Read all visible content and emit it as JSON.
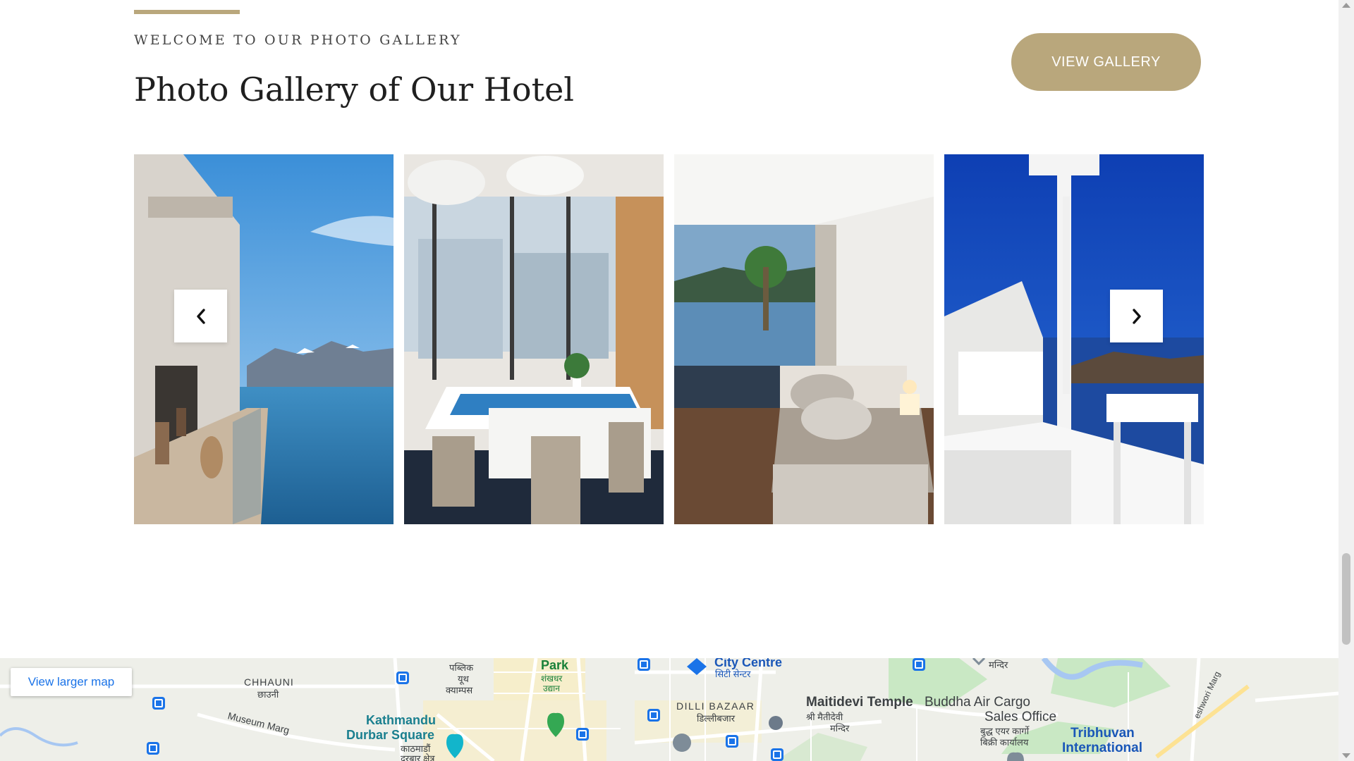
{
  "section": {
    "eyebrow": "WELCOME TO OUR PHOTO GALLERY",
    "title": "Photo Gallery of Our Hotel",
    "view_gallery_label": "VIEW GALLERY"
  },
  "gallery": {
    "photos": [
      {
        "subject": "lakeside balcony with mountains"
      },
      {
        "subject": "restaurant dining room with city view"
      },
      {
        "subject": "bedroom with lake view window"
      },
      {
        "subject": "white terrace with sea view"
      }
    ],
    "prev_icon": "chevron-left-icon",
    "next_icon": "chevron-right-icon"
  },
  "map": {
    "larger_map_label": "View larger map",
    "labels": {
      "chhauni": "CHHAUNI",
      "chhauni_np": "छाउनी",
      "museum_marg": "Museum Marg",
      "durbar_1": "Kathmandu",
      "durbar_2": "Durbar Square",
      "durbar_np": "काठमाडौं",
      "durbar_np2": "दरबार क्षेत्र",
      "park": "Park",
      "park_np1": "शंखधर",
      "park_np2": "उद्यान",
      "public_np1": "पब्लिक",
      "public_np2": "यूथ",
      "public_np3": "क्याम्पस",
      "city_centre": "City Centre",
      "city_centre_np": "सिटी सेन्टर",
      "dilli_bazaar": "DILLI BAZAAR",
      "dilli_bazaar_np": "डिल्लीबजार",
      "maitidevi": "Maitidevi Temple",
      "maitidevi_np1": "श्री मैतीदेवी",
      "maitidevi_np2": "मन्दिर",
      "buddha_1": "Buddha Air Cargo",
      "buddha_2": "Sales Office",
      "buddha_np1": "बुद्ध एयर कार्गो",
      "buddha_np2": "बिक्री कार्यालय",
      "tribhuvan_1": "Tribhuvan",
      "tribhuvan_2": "International",
      "mandir_np": "मन्दिर",
      "marg_right": "eshwori Marg"
    }
  },
  "colors": {
    "accent": "#b9a77c",
    "map_bg": "#eeefe9",
    "map_link": "#1a73e8"
  }
}
